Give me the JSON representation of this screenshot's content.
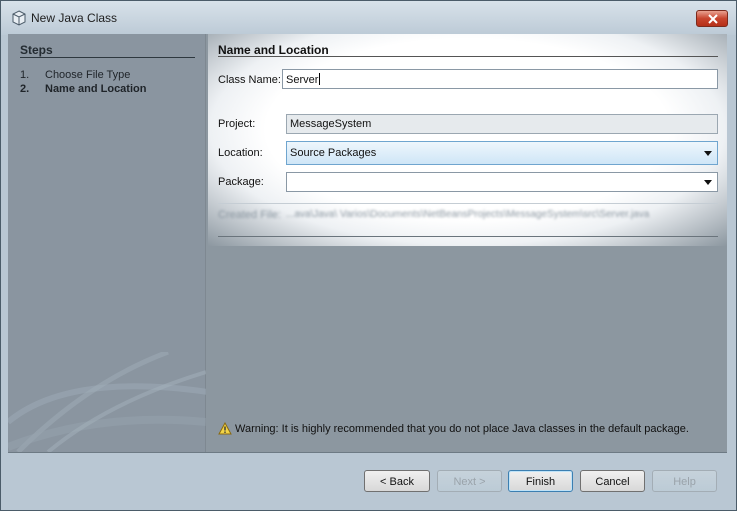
{
  "window": {
    "title": "New Java Class"
  },
  "steps": {
    "title": "Steps",
    "items": [
      {
        "num": "1.",
        "label": "Choose File Type"
      },
      {
        "num": "2.",
        "label": "Name and Location"
      }
    ]
  },
  "form": {
    "section_title": "Name and Location",
    "class_name_label": "Class Name:",
    "class_name_value": "Server",
    "project_label": "Project:",
    "project_value": "MessageSystem",
    "location_label": "Location:",
    "location_value": "Source Packages",
    "package_label": "Package:",
    "package_value": "",
    "created_file_label": "Created File:",
    "created_file_value": "...ava\\Java\\ Varios\\Documents\\NetBeansProjects\\MessageSystem\\src\\Server.java"
  },
  "warning": {
    "text": "Warning: It is highly recommended that you do not place Java classes in the default package."
  },
  "buttons": {
    "back": "< Back",
    "next": "Next >",
    "finish": "Finish",
    "cancel": "Cancel",
    "help": "Help"
  }
}
